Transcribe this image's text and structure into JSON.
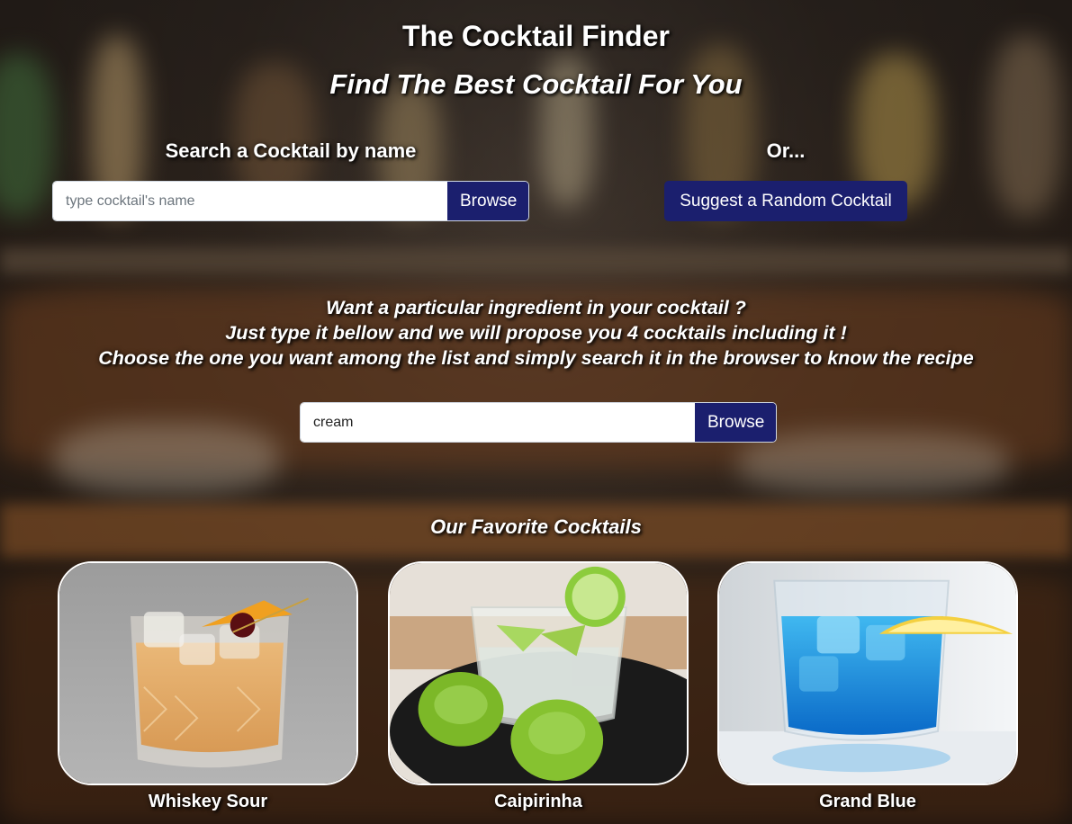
{
  "header": {
    "title": "The Cocktail Finder",
    "subtitle": "Find The Best Cocktail For You"
  },
  "name_search": {
    "label": "Search a Cocktail by name",
    "placeholder": "type cocktail's name",
    "value": "",
    "button_label": "Browse"
  },
  "random": {
    "label": "Or...",
    "button_label": "Suggest a Random Cocktail"
  },
  "ingredient_search": {
    "lines": [
      "Want a particular ingredient in your cocktail ?",
      "Just type it bellow and we will propose you 4 cocktails including it !",
      "Choose the one you want among the list and simply search it in the browser to know the recipe"
    ],
    "value": "cream",
    "placeholder": "",
    "button_label": "Browse"
  },
  "favorites": {
    "title": "Our Favorite Cocktails",
    "items": [
      {
        "name": "Whiskey Sour",
        "image_icon": "whiskey-sour-photo"
      },
      {
        "name": "Caipirinha",
        "image_icon": "caipirinha-photo"
      },
      {
        "name": "Grand Blue",
        "image_icon": "grand-blue-photo"
      }
    ]
  },
  "colors": {
    "button_bg": "#1b1f6e",
    "text": "#ffffff",
    "card_border": "#ffffff"
  }
}
